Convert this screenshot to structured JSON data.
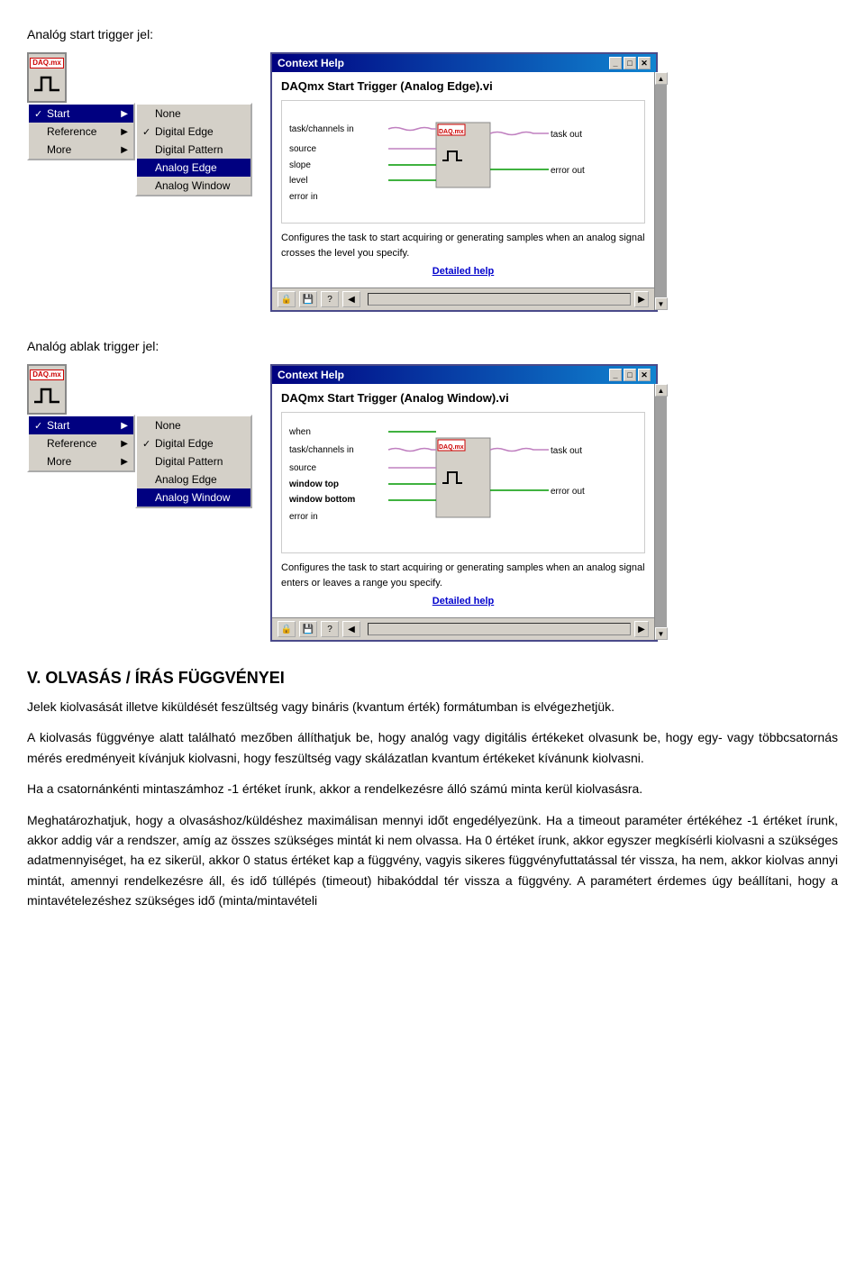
{
  "page": {
    "section1_label": "Analóg start trigger jel:",
    "section2_label": "Analóg ablak trigger jel:",
    "main_section_title": "V. OLVASÁS / ÍRÁS FÜGGVÉNYEI",
    "paragraph1": "Jelek kiolvasását illetve kiküldését feszültség vagy bináris (kvantum érték) formátumban is elvégezhetjük.",
    "paragraph2": "A kiolvasás függvénye alatt található mezőben állíthatjuk be, hogy analóg vagy digitális értékeket olvasunk be, hogy egy- vagy többcsatornás mérés eredményeit kívánjuk kiolvasni, hogy feszültség vagy skálázatlan kvantum értékeket kívánunk kiolvasni.",
    "paragraph3": "Ha a csatornánkénti mintaszámhoz -1 értéket írunk, akkor a rendelkezésre álló számú minta kerül kiolvasásra.",
    "paragraph4": "Meghatározhatjuk, hogy a olvasáshoz/küldéshez maximálisan mennyi időt engedélyezünk. Ha a timeout paraméter értékéhez -1 értéket írunk, akkor addig vár a rendszer, amíg az összes szükséges mintát ki nem olvassa. Ha 0 értéket írunk, akkor egyszer megkísérli kiolvasni a szükséges adatmennyiséget, ha ez sikerül, akkor 0 status értéket kap a függvény, vagyis sikeres függvényfuttatással tér vissza, ha nem, akkor kiolvas annyi mintát, amennyi rendelkezésre áll, és idő túllépés (timeout) hibakóddal tér vissza a függvény. A paramétert érdemes úgy beállítani, hogy a mintavételezéshez szükséges idő (minta/mintavételi"
  },
  "widget1": {
    "daq_label": "DAQ.mx",
    "trigger_char": "⌐¬",
    "menu": {
      "start_label": "Start",
      "start_has_arrow": true,
      "start_highlighted": true,
      "items": [
        {
          "id": "none",
          "check": "",
          "label": "None",
          "arrow": ""
        },
        {
          "id": "digital-edge",
          "check": "✓",
          "label": "Digital Edge",
          "arrow": ""
        },
        {
          "id": "digital-pattern",
          "check": "",
          "label": "Digital Pattern",
          "arrow": ""
        },
        {
          "id": "analog-edge",
          "check": "",
          "label": "Analog Edge",
          "arrow": "",
          "highlighted": true
        },
        {
          "id": "analog-window",
          "check": "",
          "label": "Analog Window",
          "arrow": ""
        }
      ],
      "reference_label": "Reference",
      "more_label": "More"
    }
  },
  "widget2": {
    "daq_label": "DAQ.mx",
    "trigger_char": "⌐¬",
    "menu": {
      "start_label": "Start",
      "start_has_arrow": true,
      "start_highlighted": true,
      "items": [
        {
          "id": "none",
          "check": "",
          "label": "None",
          "arrow": ""
        },
        {
          "id": "digital-edge",
          "check": "✓",
          "label": "Digital Edge",
          "arrow": ""
        },
        {
          "id": "digital-pattern",
          "check": "",
          "label": "Digital Pattern",
          "arrow": ""
        },
        {
          "id": "analog-edge",
          "check": "",
          "label": "Analog Edge",
          "arrow": ""
        },
        {
          "id": "analog-window",
          "check": "",
          "label": "Analog Window",
          "arrow": "",
          "highlighted": true
        }
      ],
      "reference_label": "Reference",
      "more_label": "More"
    }
  },
  "help1": {
    "title": "Context Help",
    "vi_title": "DAQmx Start Trigger (Analog Edge).vi",
    "help_text": "Configures the task to start acquiring or generating samples when an analog signal crosses the level you specify.",
    "detailed_help": "Detailed help",
    "inputs": [
      "task/channels in",
      "source",
      "slope",
      "level",
      "error in"
    ],
    "outputs": [
      "task out",
      "error out"
    ]
  },
  "help2": {
    "title": "Context Help",
    "vi_title": "DAQmx Start Trigger (Analog Window).vi",
    "help_text": "Configures the task to start acquiring or generating samples when an analog signal enters or leaves a range you specify.",
    "detailed_help": "Detailed help",
    "inputs": [
      "when",
      "task/channels in",
      "source",
      "window top",
      "window bottom",
      "error in"
    ],
    "outputs": [
      "task out",
      "error out"
    ]
  }
}
